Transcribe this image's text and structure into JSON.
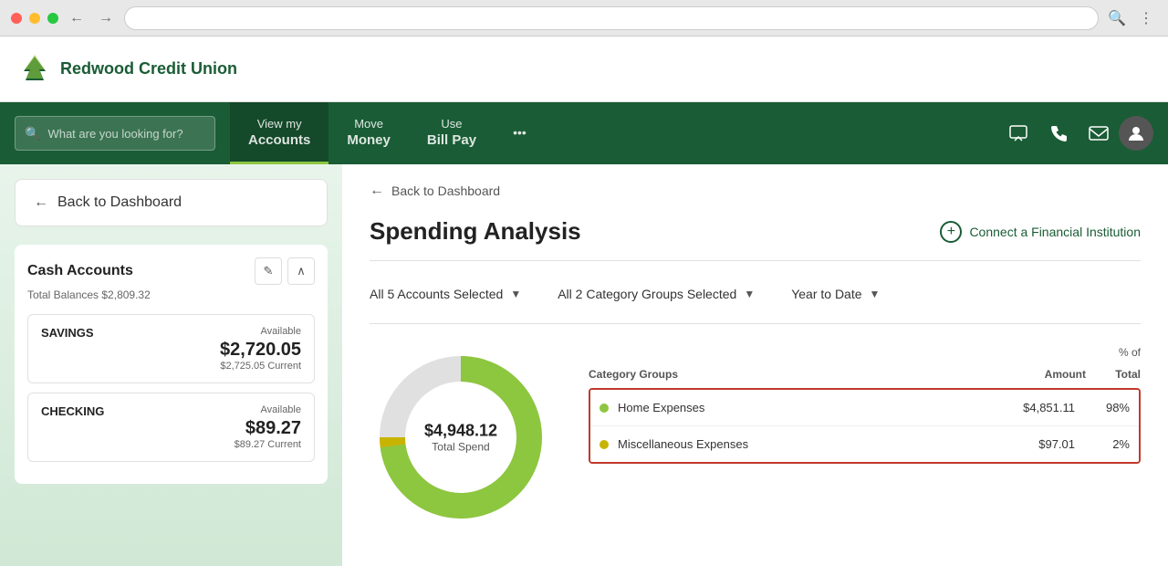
{
  "browser": {
    "address": ""
  },
  "header": {
    "logo_text": "Redwood Credit Union"
  },
  "nav": {
    "search_placeholder": "What are you looking for?",
    "items": [
      {
        "top": "View my",
        "bottom": "Accounts",
        "active": true
      },
      {
        "top": "Move",
        "bottom": "Money",
        "active": false
      },
      {
        "top": "Use",
        "bottom": "Bill Pay",
        "active": false
      }
    ],
    "more_label": "•••"
  },
  "sidebar": {
    "back_label": "Back to Dashboard",
    "accounts_section": {
      "title": "Cash Accounts",
      "total_label": "Total Balances $2,809.32",
      "accounts": [
        {
          "name": "SAVINGS",
          "available_label": "Available",
          "balance": "$2,720.05",
          "current_label": "$2,725.05 Current"
        },
        {
          "name": "CHECKING",
          "available_label": "Available",
          "balance": "$89.27",
          "current_label": "$89.27 Current"
        }
      ]
    }
  },
  "main": {
    "breadcrumb": "Back to Dashboard",
    "page_title": "Spending Analysis",
    "connect_btn": "Connect a Financial Institution",
    "filters": {
      "accounts": "All 5 Accounts Selected",
      "categories": "All 2 Category Groups Selected",
      "date": "Year to Date"
    },
    "donut": {
      "amount": "$4,948.12",
      "label": "Total Spend"
    },
    "table": {
      "pct_header": "% of",
      "total_header": "Total",
      "col_category": "Category Groups",
      "col_amount": "Amount",
      "col_pct": "% of Total",
      "rows": [
        {
          "name": "Home Expenses",
          "amount": "$4,851.11",
          "pct": "98%",
          "dot_color": "green"
        },
        {
          "name": "Miscellaneous Expenses",
          "amount": "$97.01",
          "pct": "2%",
          "dot_color": "yellow"
        }
      ]
    }
  }
}
